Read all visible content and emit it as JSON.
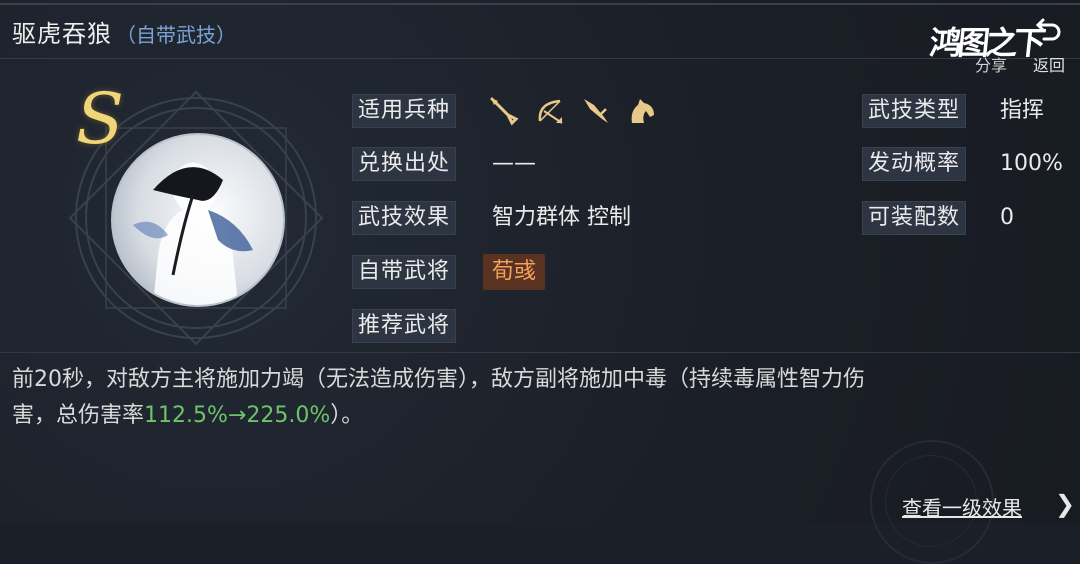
{
  "header": {
    "title": "驱虎吞狼",
    "subtitle": "（自带武技）",
    "share_label": "分享",
    "back_label": "返回",
    "logo_text": "鸿图之下"
  },
  "skill": {
    "grade": "S"
  },
  "attributes": {
    "troops": {
      "label": "适用兵种",
      "icons": [
        "spear-icon",
        "bow-icon",
        "blade-icon",
        "horse-icon"
      ]
    },
    "source": {
      "label": "兑换出处",
      "value": "——"
    },
    "effect": {
      "label": "武技效果",
      "value": "智力群体 控制"
    },
    "own_hero": {
      "label": "自带武将",
      "value": "荀彧"
    },
    "recommend": {
      "label": "推荐武将",
      "value": ""
    },
    "type": {
      "label": "武技类型",
      "value": "指挥"
    },
    "chance": {
      "label": "发动概率",
      "value": "100%"
    },
    "slots": {
      "label": "可装配数",
      "value": "0"
    }
  },
  "description": {
    "line1": "前20秒，对敌方主将施加力竭（无法造成伤害），敌方副将施加中毒（持续毒属性智力伤",
    "line2_prefix": "害，总伤害率",
    "line2_highlight": "112.5%→225.0%",
    "line2_suffix": "）。"
  },
  "footer": {
    "view_more_label": "查看一级效果"
  },
  "colors": {
    "accent_gold": "#f0d57a",
    "subtitle_blue": "#7aa3d6",
    "highlight_green": "#6fc36a",
    "tag_bg": "#5a3222",
    "tag_text": "#f2a25a"
  }
}
